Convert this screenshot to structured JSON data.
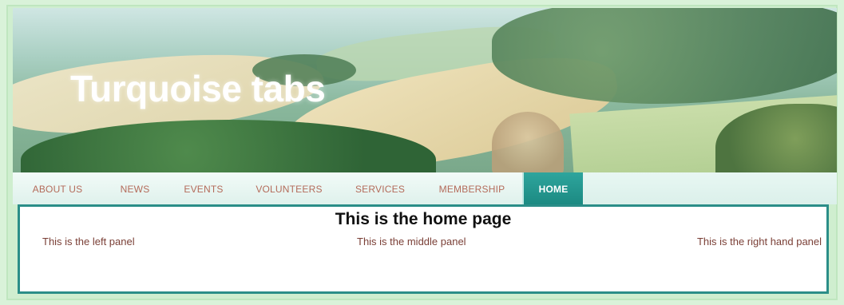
{
  "header": {
    "title": "Turquoise tabs"
  },
  "nav": {
    "tabs": [
      {
        "label": "ABOUT US",
        "active": false
      },
      {
        "label": "NEWS",
        "active": false
      },
      {
        "label": "EVENTS",
        "active": false
      },
      {
        "label": "VOLUNTEERS",
        "active": false
      },
      {
        "label": "SERVICES",
        "active": false
      },
      {
        "label": "MEMBERSHIP",
        "active": false
      },
      {
        "label": "HOME",
        "active": true
      }
    ]
  },
  "main": {
    "heading": "This is the home page",
    "left_panel": "This is the left panel",
    "middle_panel": "This is the middle panel",
    "right_panel": "This is the right hand panel"
  },
  "colors": {
    "accent": "#1c8a82",
    "tab_text": "#b46b5a",
    "page_background": "#d9f2d9"
  }
}
